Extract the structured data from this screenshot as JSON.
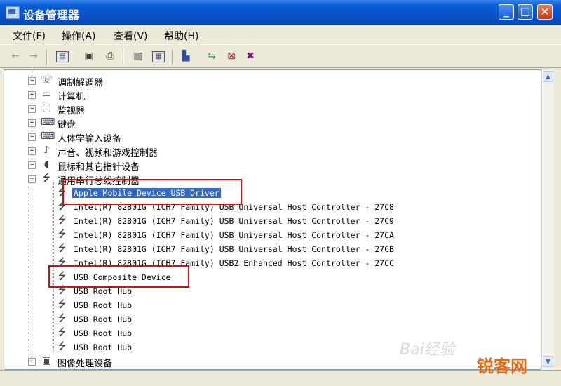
{
  "window": {
    "title": "设备管理器"
  },
  "title_buttons": {
    "minimize": "_",
    "maximize": "□",
    "close": "×"
  },
  "menu": [
    {
      "label": "文件(F)"
    },
    {
      "label": "操作(A)"
    },
    {
      "label": "查看(V)"
    },
    {
      "label": "帮助(H)"
    }
  ],
  "toolbar_icons": [
    "back-arrow-icon",
    "forward-arrow-icon",
    "console-tree-icon",
    "properties-icon",
    "print-icon",
    "help-icon",
    "update-driver-icon",
    "scan-hardware-icon",
    "disable-device-icon",
    "uninstall-icon"
  ],
  "tree": {
    "categories": [
      {
        "label": "调制解调器",
        "icon": "modem-icon"
      },
      {
        "label": "计算机",
        "icon": "computer-icon"
      },
      {
        "label": "监视器",
        "icon": "monitor-icon"
      },
      {
        "label": "键盘",
        "icon": "keyboard-icon"
      },
      {
        "label": "人体学输入设备",
        "icon": "hid-icon"
      },
      {
        "label": "声音、视频和游戏控制器",
        "icon": "sound-icon"
      },
      {
        "label": "鼠标和其它指针设备",
        "icon": "mouse-icon"
      },
      {
        "label": "通用串行总线控制器",
        "icon": "usb-icon"
      }
    ],
    "usb_devices": [
      {
        "label": "Apple Mobile Device USB Driver",
        "selected": true
      },
      {
        "label": "Intel(R) 82801G (ICH7 Family) USB Universal Host Controller - 27C8"
      },
      {
        "label": "Intel(R) 82801G (ICH7 Family) USB Universal Host Controller - 27C9"
      },
      {
        "label": "Intel(R) 82801G (ICH7 Family) USB Universal Host Controller - 27CA"
      },
      {
        "label": "Intel(R) 82801G (ICH7 Family) USB Universal Host Controller - 27CB"
      },
      {
        "label": "Intel(R) 82801G (ICH7 Family) USB2 Enhanced Host Controller - 27CC"
      },
      {
        "label": "USB Composite Device"
      },
      {
        "label": "USB Root Hub"
      },
      {
        "label": "USB Root Hub"
      },
      {
        "label": "USB Root Hub"
      },
      {
        "label": "USB Root Hub"
      },
      {
        "label": "USB Root Hub"
      }
    ],
    "last_category": {
      "label": "图像处理设备",
      "icon": "imaging-icon"
    }
  },
  "watermarks": {
    "baidu": "Bai经验",
    "ruike": "锐客网"
  },
  "colors": {
    "titlebar": "#0a52c9",
    "selection": "#316ac5",
    "highlight_box": "#d01010",
    "watermark_orange": "#e56a12"
  }
}
